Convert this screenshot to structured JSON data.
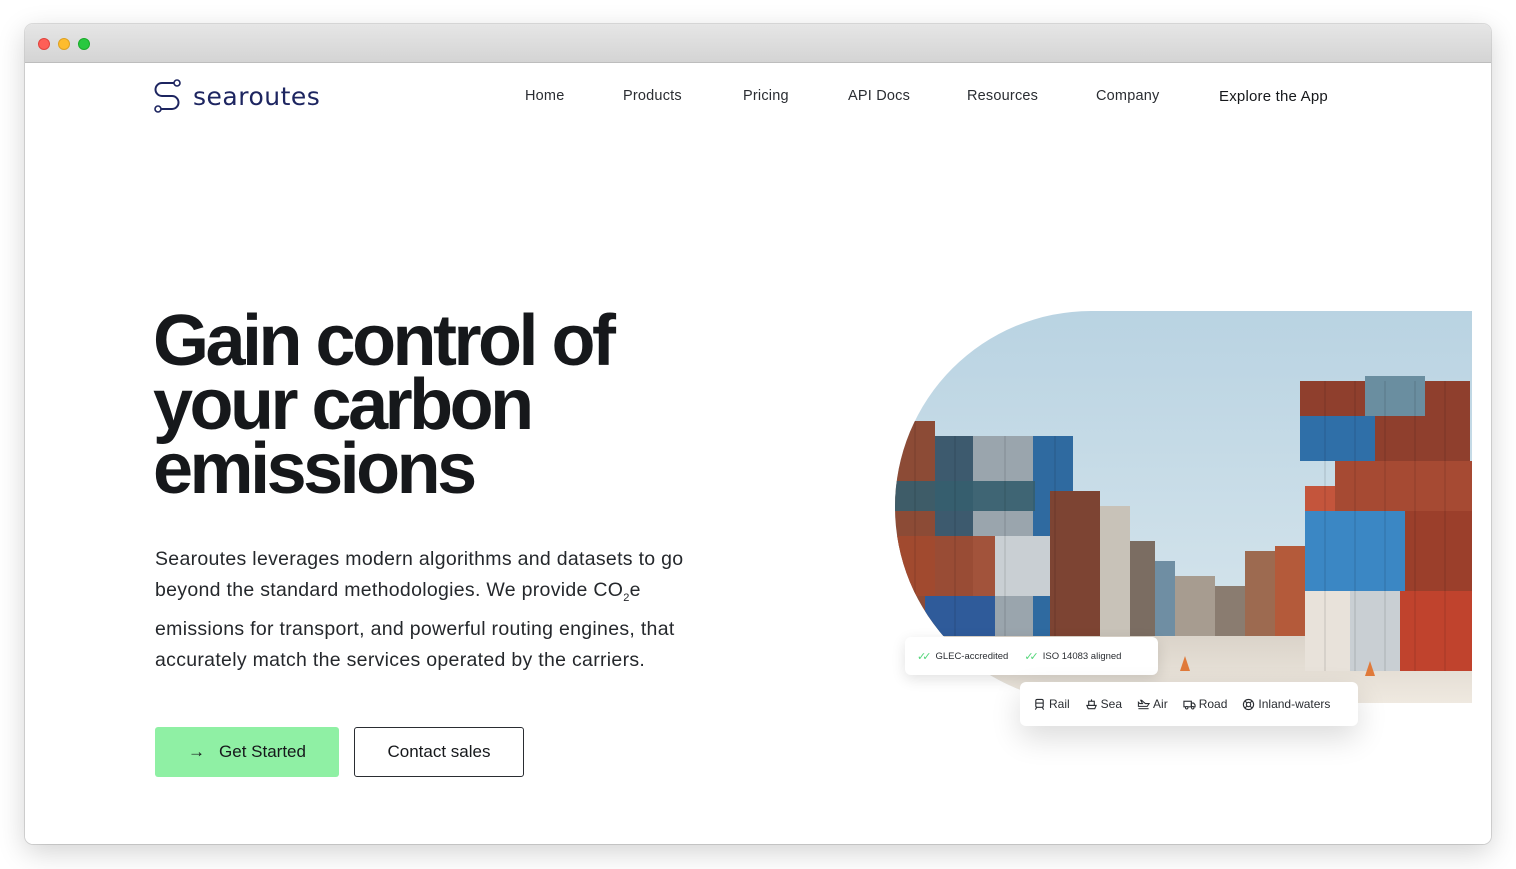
{
  "brand": {
    "name": "searoutes"
  },
  "nav": {
    "items": [
      {
        "label": "Home"
      },
      {
        "label": "Products"
      },
      {
        "label": "Pricing"
      },
      {
        "label": "API Docs"
      },
      {
        "label": "Resources"
      },
      {
        "label": "Company"
      }
    ],
    "cta": "Explore the App"
  },
  "hero": {
    "title_lines": [
      "Gain control of",
      "your carbon",
      "emissions"
    ],
    "description_part1": "Searoutes leverages modern algorithms and datasets to go beyond the standard methodologies. We provide CO",
    "description_sub": "2",
    "description_part2": "e emissions for transport, and powerful routing engines, that accurately match the services operated by the carriers.",
    "primary_button": "Get Started",
    "secondary_button": "Contact sales"
  },
  "badges": [
    {
      "label": "GLEC-accredited"
    },
    {
      "label": "ISO 14083 aligned"
    }
  ],
  "modes": [
    {
      "label": "Rail",
      "icon": "rail-icon"
    },
    {
      "label": "Sea",
      "icon": "ship-icon"
    },
    {
      "label": "Air",
      "icon": "plane-icon"
    },
    {
      "label": "Road",
      "icon": "truck-icon"
    },
    {
      "label": "Inland-waters",
      "icon": "boat-icon"
    }
  ],
  "colors": {
    "accent": "#8ff0a4",
    "brand": "#1d2560",
    "check": "#54d67a"
  }
}
